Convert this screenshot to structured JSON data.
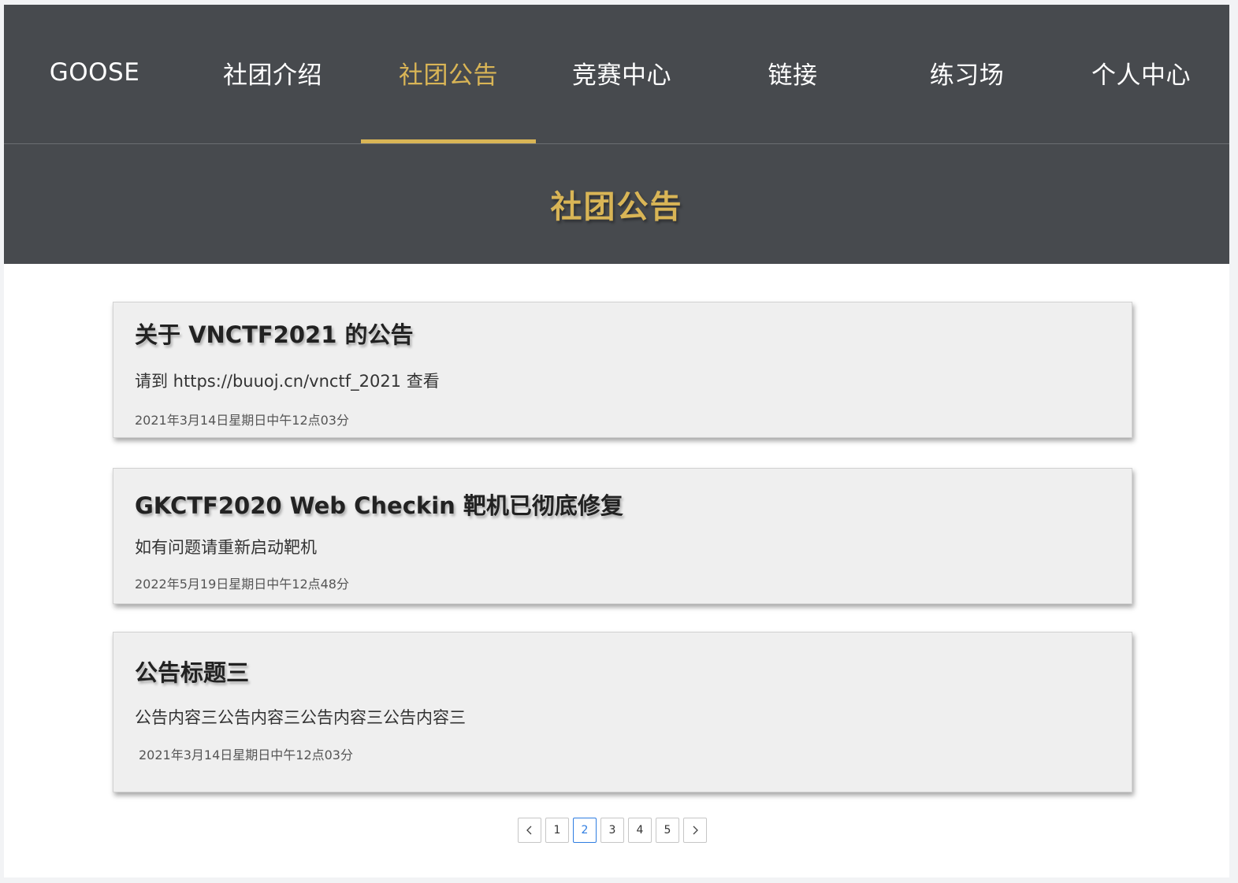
{
  "nav": {
    "items": [
      {
        "label": "GOOSE"
      },
      {
        "label": "社团介绍"
      },
      {
        "label": "社团公告"
      },
      {
        "label": "竞赛中心"
      },
      {
        "label": "链接"
      },
      {
        "label": "练习场"
      },
      {
        "label": "个人中心"
      }
    ],
    "active_index": 2
  },
  "page": {
    "title": "社团公告"
  },
  "announcements": [
    {
      "title": "关于 VNCTF2021 的公告",
      "content": "请到 https://buuoj.cn/vnctf_2021 查看",
      "date": "2021年3月14日星期日中午12点03分"
    },
    {
      "title": "GKCTF2020 Web Checkin 靶机已彻底修复",
      "content": "如有问题请重新启动靶机",
      "date": "2022年5月19日星期日中午12点48分"
    },
    {
      "title": "公告标题三",
      "content": "公告内容三公告内容三公告内容三公告内容三",
      "date": "2021年3月14日星期日中午12点03分"
    }
  ],
  "pagination": {
    "prev_icon": "chevron-left-icon",
    "next_icon": "chevron-right-icon",
    "pages": [
      "1",
      "2",
      "3",
      "4",
      "5"
    ],
    "current": "2"
  },
  "colors": {
    "header_bg": "#474a4e",
    "accent": "#d9b556",
    "card_bg": "#efefef",
    "page_active": "#2f7de1"
  }
}
